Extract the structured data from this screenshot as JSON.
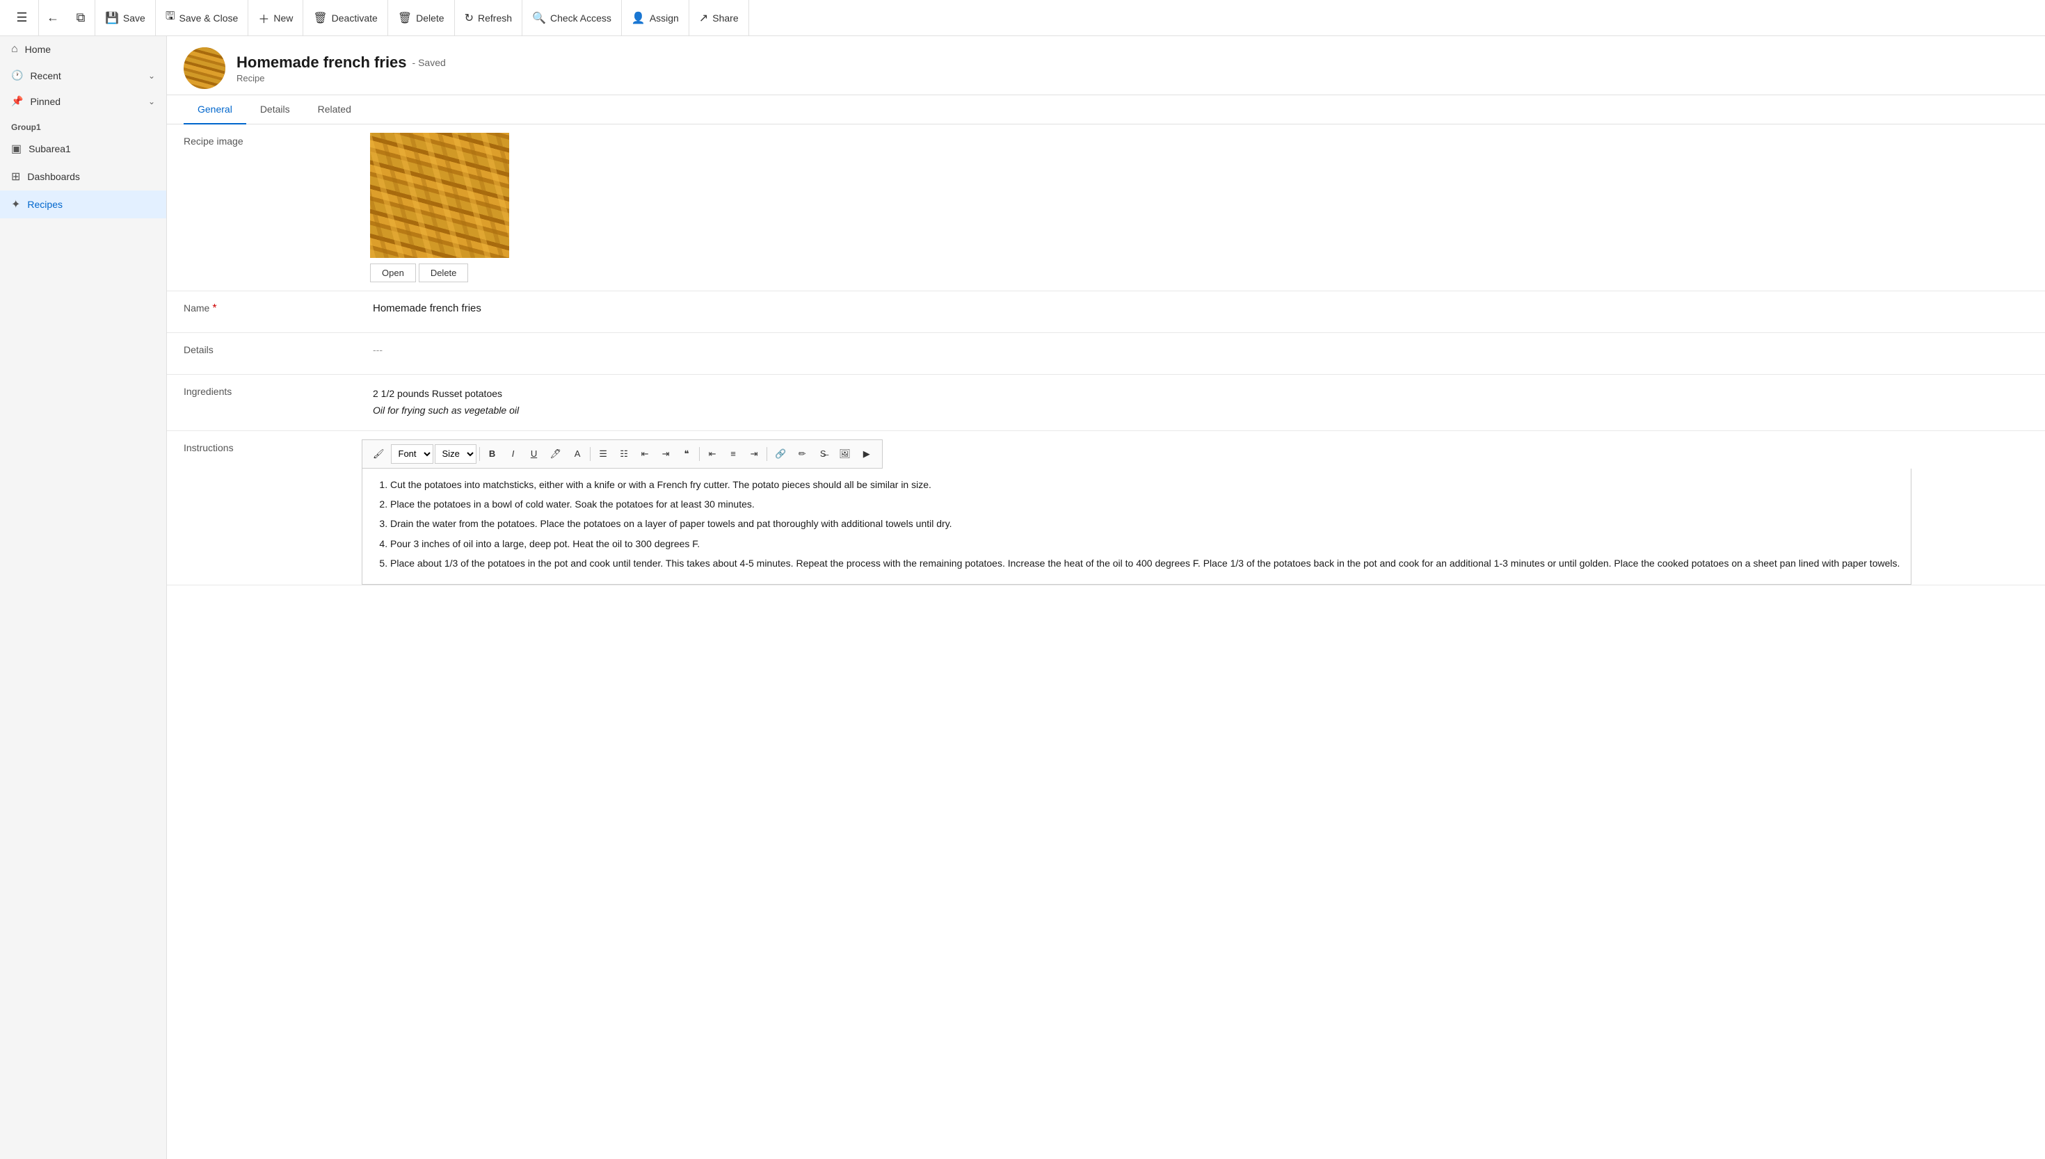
{
  "toolbar": {
    "save_label": "Save",
    "save_close_label": "Save & Close",
    "new_label": "New",
    "deactivate_label": "Deactivate",
    "delete_label": "Delete",
    "refresh_label": "Refresh",
    "check_access_label": "Check Access",
    "assign_label": "Assign",
    "share_label": "Share"
  },
  "record": {
    "title": "Homemade french fries",
    "saved_status": "- Saved",
    "type": "Recipe"
  },
  "tabs": [
    {
      "id": "general",
      "label": "General",
      "active": true
    },
    {
      "id": "details",
      "label": "Details",
      "active": false
    },
    {
      "id": "related",
      "label": "Related",
      "active": false
    }
  ],
  "form": {
    "image_label": "Recipe image",
    "image_open_btn": "Open",
    "image_delete_btn": "Delete",
    "name_label": "Name",
    "name_required": "*",
    "name_value": "Homemade french fries",
    "details_label": "Details",
    "details_value": "---",
    "ingredients_label": "Ingredients",
    "ingredients_line1": "2 1/2 pounds Russet potatoes",
    "ingredients_line2": "Oil for frying such as vegetable oil",
    "instructions_label": "Instructions",
    "instructions": [
      "Cut the potatoes into matchsticks, either with a knife or with a French fry cutter. The potato pieces should all be similar in size.",
      "Place the potatoes in a bowl of cold water. Soak the potatoes for at least 30 minutes.",
      "Drain the water from the potatoes. Place the potatoes on a layer of paper towels and pat thoroughly with additional towels until dry.",
      "Pour 3 inches of oil into a large, deep pot. Heat the oil to 300 degrees F.",
      "Place about 1/3 of the potatoes in the pot and cook until tender. This takes about 4-5 minutes. Repeat the process with the remaining potatoes. Increase the heat of the oil to 400 degrees F. Place 1/3 of the potatoes back in the pot and cook for an additional 1-3 minutes or until golden. Place the cooked potatoes on a sheet pan lined with paper towels."
    ]
  },
  "sidebar": {
    "menu_icon": "☰",
    "items": [
      {
        "id": "home",
        "label": "Home",
        "icon": "⌂"
      },
      {
        "id": "recent",
        "label": "Recent",
        "icon": "🕐",
        "expandable": true
      },
      {
        "id": "pinned",
        "label": "Pinned",
        "icon": "📌",
        "expandable": true
      }
    ],
    "group1_label": "Group1",
    "group1_items": [
      {
        "id": "subarea1",
        "label": "Subarea1",
        "icon": "▣"
      },
      {
        "id": "dashboards",
        "label": "Dashboards",
        "icon": "⊞"
      },
      {
        "id": "recipes",
        "label": "Recipes",
        "icon": "✦",
        "active": true
      }
    ]
  },
  "editor": {
    "font_label": "Font",
    "size_label": "Size"
  }
}
